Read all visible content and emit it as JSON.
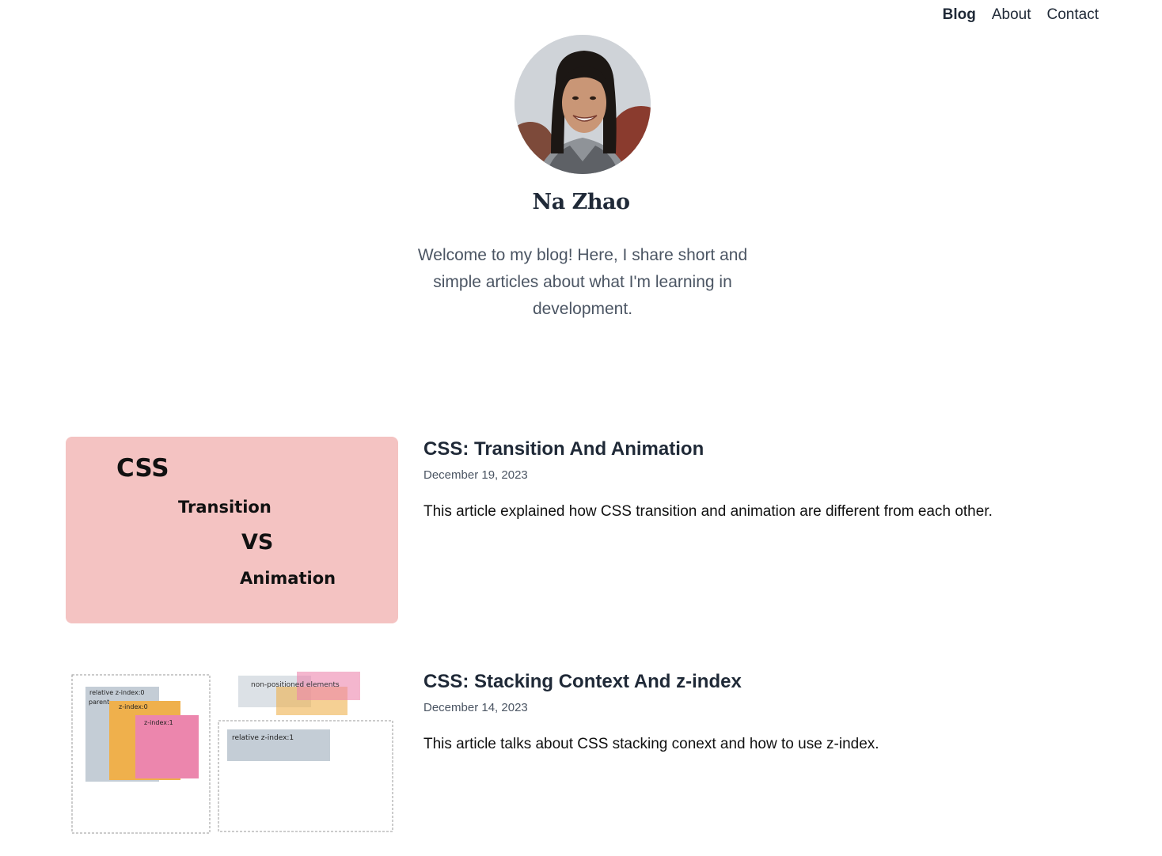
{
  "nav": {
    "items": [
      {
        "label": "Blog",
        "active": true
      },
      {
        "label": "About",
        "active": false
      },
      {
        "label": "Contact",
        "active": false
      }
    ]
  },
  "profile": {
    "name": "Na Zhao",
    "intro": "Welcome to my blog! Here, I share short and simple articles about what I'm learning in development."
  },
  "posts": [
    {
      "title": "CSS: Transition And Animation",
      "date": "December 19, 2023",
      "excerpt": "This article explained how CSS transition and animation are different from each other.",
      "thumbnail": {
        "background": "#f4c3c2",
        "lines": [
          "CSS",
          "Transition",
          "VS",
          "Animation"
        ]
      }
    },
    {
      "title": "CSS: Stacking Context And z-index",
      "date": "December 14, 2023",
      "excerpt": "This article talks about CSS stacking conext and how to use z-index.",
      "thumbnail": {
        "labels": [
          "relative z-index:0",
          "parent",
          "z-index:0",
          "z-index:1",
          "non-positioned elements",
          "relative z-index:1"
        ]
      }
    }
  ],
  "colors": {
    "text": "#1f2937",
    "muted": "#4b5563",
    "thumb_pink": "#f4c3c2",
    "box_gray": "#c4cdd6",
    "box_orange": "#efb04c",
    "box_pink": "#ec86ad"
  }
}
